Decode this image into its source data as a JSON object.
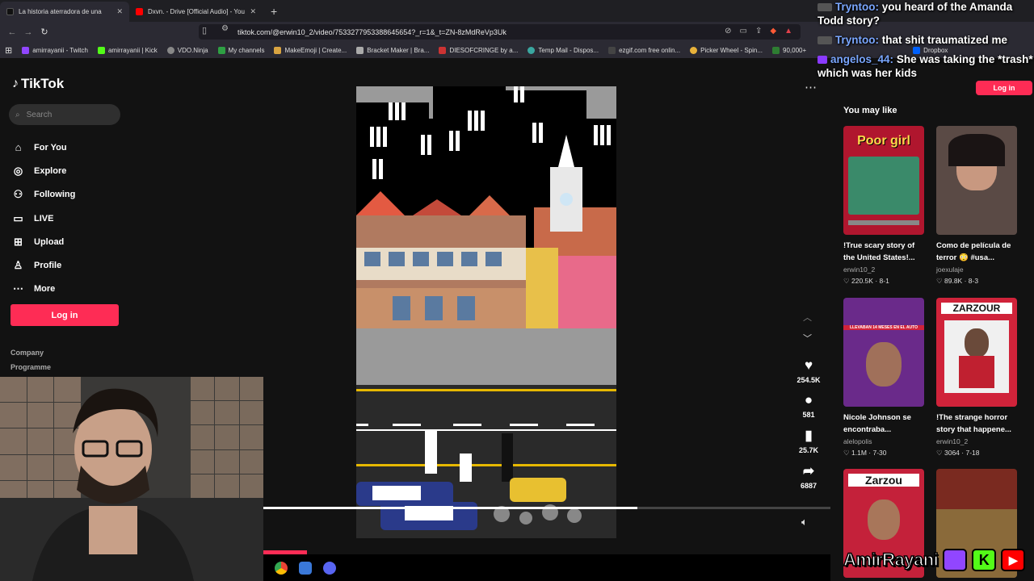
{
  "browser": {
    "tabs": [
      {
        "label": "La historia aterradora de una",
        "active": true
      },
      {
        "label": "Dxvn. - Drive [Official Audio] - YouTu",
        "active": false
      }
    ],
    "url": "tiktok.com/@erwin10_2/video/7533277953388645654?_r=1&_t=ZN-8zMdReVp3Uk",
    "bookmarks": [
      "amirrayanii - Twitch",
      "amirrayanii | Kick",
      "VDO.Ninja",
      "My channels",
      "MakeEmoji | Create...",
      "Bracket Maker | Bra...",
      "DIESOFCRINGE by a...",
      "Temp Mail - Dispos...",
      "ezgif.com free onlin...",
      "Picker Wheel - Spin...",
      "90,000+",
      "Dropbox"
    ]
  },
  "sidebar": {
    "logo": "TikTok",
    "search_placeholder": "Search",
    "nav": [
      {
        "label": "For You",
        "icon": "home-icon"
      },
      {
        "label": "Explore",
        "icon": "compass-icon"
      },
      {
        "label": "Following",
        "icon": "following-icon"
      },
      {
        "label": "LIVE",
        "icon": "live-icon"
      },
      {
        "label": "Upload",
        "icon": "upload-icon"
      },
      {
        "label": "Profile",
        "icon": "profile-icon"
      },
      {
        "label": "More",
        "icon": "more-icon"
      }
    ],
    "login": "Log in",
    "footer": [
      "Company",
      "Programme"
    ]
  },
  "video": {
    "likes": "254.5K",
    "comments": "581",
    "saves": "25.7K",
    "shares": "6887",
    "progress": 0.66
  },
  "right": {
    "login": "Log in",
    "heading": "You may like",
    "cards": [
      {
        "title": "!True scary story of the United States!...",
        "author": "erwin10_2",
        "likes": "220.5K",
        "date": "8-1",
        "overlay": "Poor girl",
        "bg": "#b0162e"
      },
      {
        "title": "Como de película de terror 😳 #usa...",
        "author": "joexulaje",
        "likes": "89.8K",
        "date": "8-3",
        "overlay": "",
        "bg": "#5a4a45"
      },
      {
        "title": "Nicole Johnson se encontraba...",
        "author": "alelopolis",
        "likes": "1.1M",
        "date": "7-30",
        "overlay": "LLEVABAN 14 MESES EN EL AUTO",
        "bg": "#6a2a8a"
      },
      {
        "title": "!The strange horror story that happene...",
        "author": "erwin10_2",
        "likes": "3064",
        "date": "7-18",
        "overlay": "ZARZOUR",
        "bg": "#d0233a"
      },
      {
        "title": "",
        "author": "",
        "likes": "",
        "date": "",
        "overlay": "Zarzou",
        "bg": "#c4213a"
      },
      {
        "title": "",
        "author": "",
        "likes": "",
        "date": "",
        "overlay": "",
        "bg": "#7a2a20"
      }
    ]
  },
  "chat": [
    {
      "user": "Tryntoo:",
      "msg": "you heard of the Amanda Todd story?"
    },
    {
      "user": "Tryntoo:",
      "msg": "that shit traumatized me"
    },
    {
      "user": "angelos_44:",
      "msg": "She was taking the *trash* which was her kids"
    }
  ],
  "brand": {
    "name": "AmirRayani",
    "k": "K"
  }
}
